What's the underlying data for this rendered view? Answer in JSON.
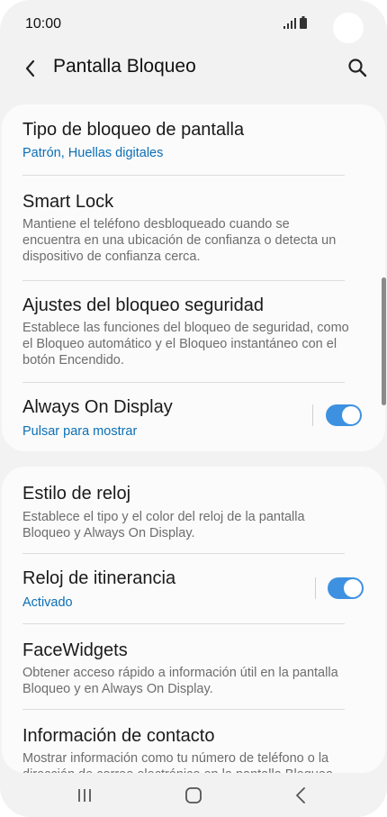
{
  "status_bar": {
    "time": "10:00"
  },
  "header": {
    "title": "Pantalla Bloqueo"
  },
  "section1": [
    {
      "title": "Tipo de bloqueo de pantalla",
      "subtitle": "Patrón, Huellas digitales"
    },
    {
      "title": "Smart Lock",
      "subtitle": "Mantiene el teléfono desbloqueado cuando se encuentra en una ubicación de confianza o detecta un dispositivo de confianza cerca."
    },
    {
      "title": "Ajustes del bloqueo seguridad",
      "subtitle": "Establece las funciones del bloqueo de seguridad, como el Bloqueo automático y el Bloqueo instantáneo con el botón Encendido."
    },
    {
      "title": "Always On Display",
      "subtitle": "Pulsar para mostrar",
      "toggle_on": true
    }
  ],
  "section2": [
    {
      "title": "Estilo de reloj",
      "subtitle": "Establece el tipo y el color del reloj de la pantalla Bloqueo y Always On Display."
    },
    {
      "title": "Reloj de itinerancia",
      "subtitle": "Activado",
      "toggle_on": true
    },
    {
      "title": "FaceWidgets",
      "subtitle": "Obtener acceso rápido a información útil en la pantalla Bloqueo y en Always On Display."
    },
    {
      "title": "Información de contacto",
      "subtitle": "Mostrar información como tu número de teléfono o la dirección de correo electrónico en la pantalla Bloqueo."
    }
  ],
  "colors": {
    "accent": "#0c6fb6",
    "toggle": "#3e91e0"
  },
  "icons": {
    "back": "chevron-left-icon",
    "search": "search-icon",
    "nav_recent": "recent-apps-icon",
    "nav_home": "home-icon",
    "nav_back": "back-icon"
  }
}
